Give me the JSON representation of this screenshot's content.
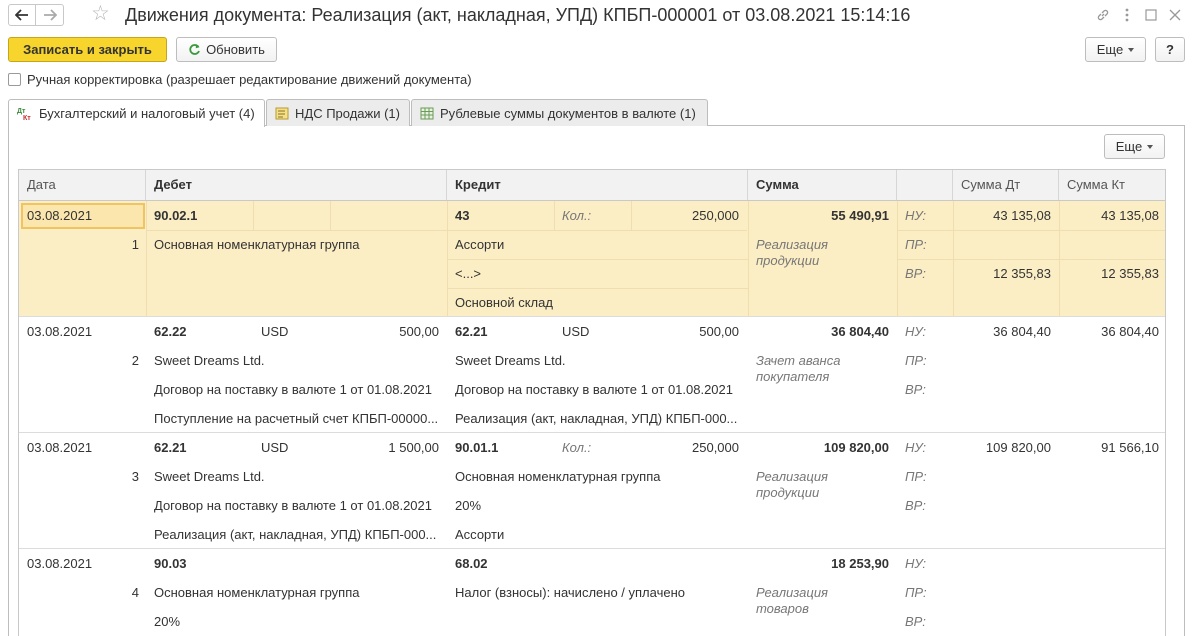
{
  "window": {
    "title": "Движения документа: Реализация (акт, накладная, УПД) КПБП-000001 от 03.08.2021 15:14:16"
  },
  "toolbar": {
    "save_close": "Записать и закрыть",
    "refresh": "Обновить",
    "more": "Еще",
    "help": "?"
  },
  "manual_edit": "Ручная корректировка (разрешает редактирование движений документа)",
  "tabs": [
    {
      "label": "Бухгалтерский и налоговый учет (4)",
      "icon": "dt-kt-icon"
    },
    {
      "label": "НДС Продажи (1)",
      "icon": "register-icon"
    },
    {
      "label": "Рублевые суммы документов в валюте (1)",
      "icon": "table-icon"
    }
  ],
  "grid_more": "Еще",
  "columns": {
    "date": "Дата",
    "debit": "Дебет",
    "credit": "Кредит",
    "sum": "Сумма",
    "sum_dt": "Сумма Дт",
    "sum_kt": "Сумма Кт"
  },
  "marks": {
    "nu": "НУ:",
    "pr": "ПР:",
    "vr": "ВР:",
    "qty": "Кол.:"
  },
  "records": [
    {
      "date": "03.08.2021",
      "num": "1",
      "dt_acc": "90.02.1",
      "dt_cur": "",
      "dt_amt": "",
      "dt_sub": [
        "Основная номенклатурная группа",
        "",
        ""
      ],
      "kt_acc": "43",
      "kt_cur": "",
      "kt_amt": "250,000",
      "kt_qty": true,
      "kt_sub": [
        "Ассорти",
        "<...>",
        "Основной склад"
      ],
      "sum": "55 490,91",
      "content": "Реализация продукции",
      "nu_dt": "43 135,08",
      "nu_kt": "43 135,08",
      "pr_dt": "",
      "pr_kt": "",
      "vr_dt": "12 355,83",
      "vr_kt": "12 355,83"
    },
    {
      "date": "03.08.2021",
      "num": "2",
      "dt_acc": "62.22",
      "dt_cur": "USD",
      "dt_amt": "500,00",
      "dt_sub": [
        "Sweet Dreams Ltd.",
        "Договор на поставку в валюте 1 от 01.08.2021",
        "Поступление на расчетный счет КПБП-00000..."
      ],
      "kt_acc": "62.21",
      "kt_cur": "USD",
      "kt_amt": "500,00",
      "kt_qty": false,
      "kt_sub": [
        "Sweet Dreams Ltd.",
        "Договор на поставку в валюте 1 от 01.08.2021",
        "Реализация (акт, накладная, УПД) КПБП-000..."
      ],
      "sum": "36 804,40",
      "content": "Зачет аванса покупателя",
      "nu_dt": "36 804,40",
      "nu_kt": "36 804,40",
      "pr_dt": "",
      "pr_kt": "",
      "vr_dt": "",
      "vr_kt": ""
    },
    {
      "date": "03.08.2021",
      "num": "3",
      "dt_acc": "62.21",
      "dt_cur": "USD",
      "dt_amt": "1 500,00",
      "dt_sub": [
        "Sweet Dreams Ltd.",
        "Договор на поставку в валюте 1 от 01.08.2021",
        "Реализация (акт, накладная, УПД) КПБП-000..."
      ],
      "kt_acc": "90.01.1",
      "kt_cur": "",
      "kt_amt": "250,000",
      "kt_qty": true,
      "kt_sub": [
        "Основная номенклатурная группа",
        "20%",
        "Ассорти"
      ],
      "sum": "109 820,00",
      "content": "Реализация продукции",
      "nu_dt": "109 820,00",
      "nu_kt": "91 566,10",
      "pr_dt": "",
      "pr_kt": "",
      "vr_dt": "",
      "vr_kt": ""
    },
    {
      "date": "03.08.2021",
      "num": "4",
      "dt_acc": "90.03",
      "dt_cur": "",
      "dt_amt": "",
      "dt_sub": [
        "Основная номенклатурная группа",
        "20%",
        ""
      ],
      "kt_acc": "68.02",
      "kt_cur": "",
      "kt_amt": "",
      "kt_qty": false,
      "kt_sub": [
        "Налог (взносы): начислено / уплачено",
        "",
        ""
      ],
      "sum": "18 253,90",
      "content": "Реализация товаров",
      "nu_dt": "",
      "nu_kt": "",
      "pr_dt": "",
      "pr_kt": "",
      "vr_dt": "",
      "vr_kt": ""
    }
  ]
}
